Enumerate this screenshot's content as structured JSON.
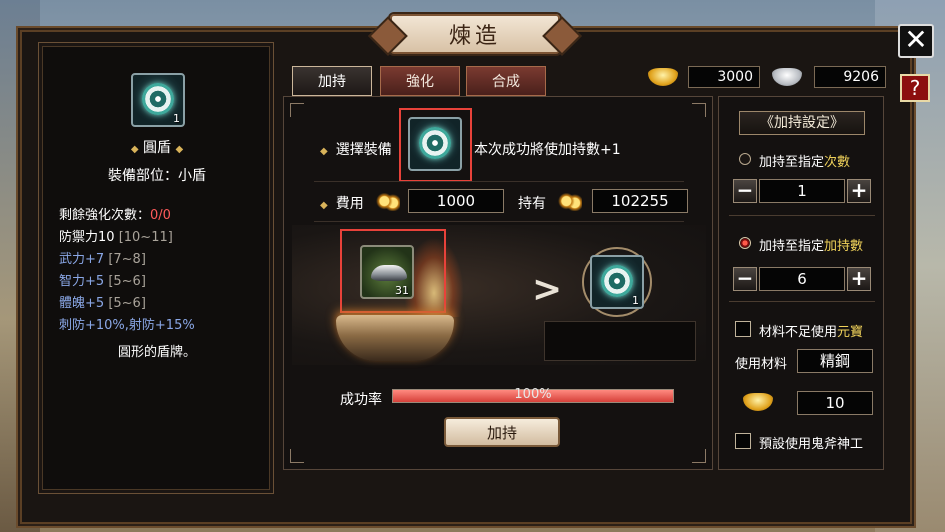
{
  "window": {
    "title": "煉造",
    "close_glyph": "✕",
    "help_glyph": "?"
  },
  "tabs": [
    {
      "label": "加持",
      "active": true
    },
    {
      "label": "強化",
      "active": false
    },
    {
      "label": "合成",
      "active": false
    }
  ],
  "currency": {
    "gold": "3000",
    "silver": "9206"
  },
  "item_info": {
    "name": "圓盾",
    "count": "1",
    "slot_line": "裝備部位：小盾",
    "remaining_label": "剩餘強化次數：",
    "remaining_value": "0/0",
    "defense_line": "防禦力10",
    "defense_range": "[10~11]",
    "str_line": "武力+7",
    "str_range": "[7~8]",
    "int_line": "智力+5",
    "int_range": "[5~6]",
    "con_line": "體魄+5",
    "con_range": "[5~6]",
    "pierce_line": "刺防+10%,射防+15%",
    "description": "圓形的盾牌。"
  },
  "main": {
    "select_label": "選擇裝備",
    "select_hint": "本次成功將使加持數+1",
    "selected_count": "1",
    "cost_label": "費用",
    "cost_value": "1000",
    "owned_label": "持有",
    "owned_value": "102255",
    "material_count": "31",
    "result_count": "1",
    "success_label": "成功率",
    "success_rate_text": "100%",
    "success_rate": 1.0,
    "enchant_button": "加持"
  },
  "settings": {
    "title": "加持設定",
    "opt1_prefix": "加持至指定",
    "opt1_highlight": "次數",
    "opt1_value": "1",
    "opt2_prefix": "加持至指定",
    "opt2_highlight": "加持數",
    "opt2_value": "6",
    "minus": "−",
    "plus": "+",
    "check1_prefix": "材料不足使用",
    "check1_highlight": "元寶",
    "material_label": "使用材料",
    "material_value": "精鋼",
    "ingot_value": "10",
    "check2_label": "預設使用鬼斧神工"
  },
  "colors": {
    "accent_red": "#e8423a",
    "highlight_yellow": "#f0d25a",
    "stat_blue": "#8aa7e6"
  }
}
